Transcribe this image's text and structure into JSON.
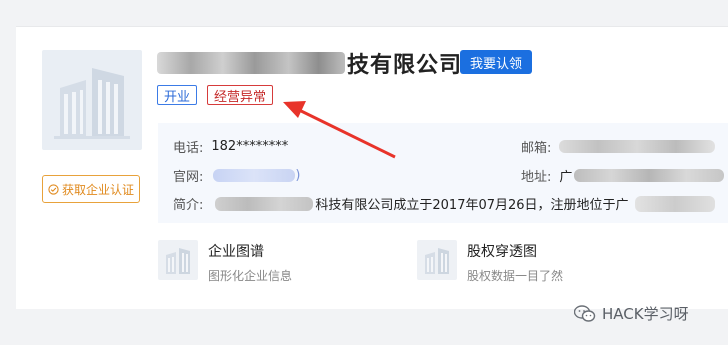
{
  "company": {
    "name_suffix": "技有限公司",
    "claim_label": "我要认领",
    "tags": {
      "open": "开业",
      "abnormal": "经营异常"
    },
    "cert_label": "获取企业认证"
  },
  "info": {
    "phone_label": "电话:",
    "phone_value": "182********",
    "email_label": "邮箱:",
    "website_label": "官网:",
    "website_tail": ")",
    "address_label": "地址:",
    "address_head": "广",
    "intro_label": "简介:",
    "intro_text": "科技有限公司成立于2017年07月26日，注册地位于广"
  },
  "features": [
    {
      "title": "企业图谱",
      "subtitle": "图形化企业信息"
    },
    {
      "title": "股权穿透图",
      "subtitle": "股权数据一目了然"
    }
  ],
  "watermark": {
    "text": "HACK学习呀"
  },
  "colors": {
    "claim": "#1b6fe0",
    "tag_open": "#3b7be6",
    "tag_abnormal": "#d63b3b",
    "cert": "#e8a23b",
    "arrow": "#e8332a"
  }
}
